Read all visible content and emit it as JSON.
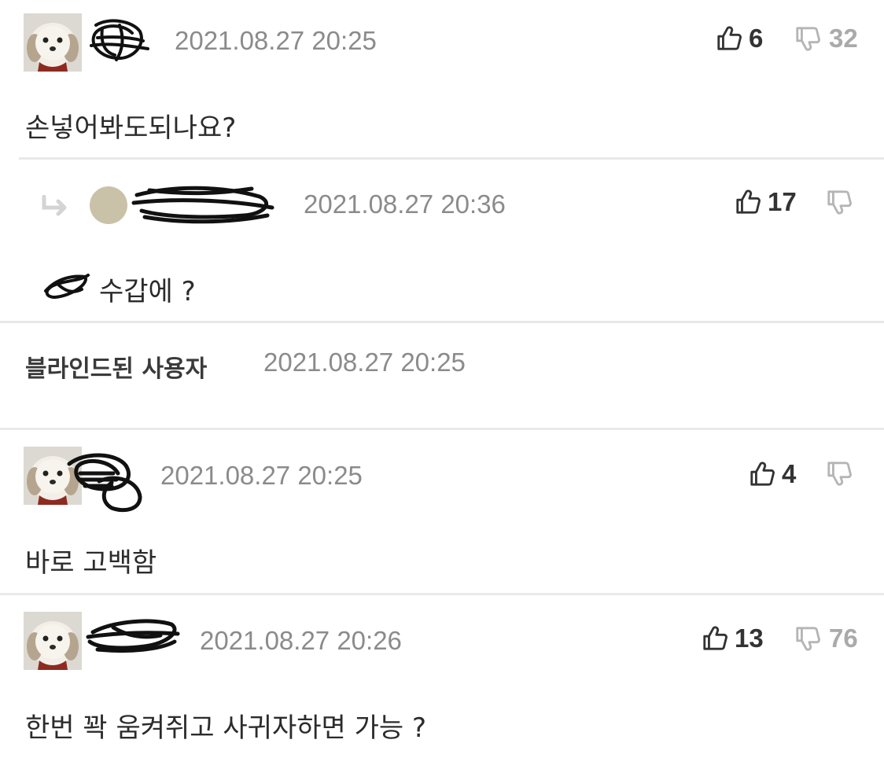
{
  "comments": [
    {
      "date": "2021.08.27 20:25",
      "text": "손넣어봐도되나요?",
      "upvotes": "6",
      "downvotes": "32",
      "reply": {
        "date": "2021.08.27 20:36",
        "text": "수갑에 ?",
        "upvotes": "17",
        "downvotes": ""
      }
    },
    {
      "blind_label": "블라인드된 사용자",
      "date": "2021.08.27 20:25"
    },
    {
      "date": "2021.08.27 20:25",
      "text": "바로 고백함",
      "upvotes": "4",
      "downvotes": ""
    },
    {
      "date": "2021.08.27 20:26",
      "text": "한번 꽉 움켜쥐고 사귀자하면 가능 ?",
      "upvotes": "13",
      "downvotes": "76"
    }
  ],
  "icons": {
    "avatar": "puppy-avatar",
    "reply": "reply-arrow-icon",
    "upvote": "thumbs-up-icon",
    "downvote": "thumbs-down-icon"
  }
}
